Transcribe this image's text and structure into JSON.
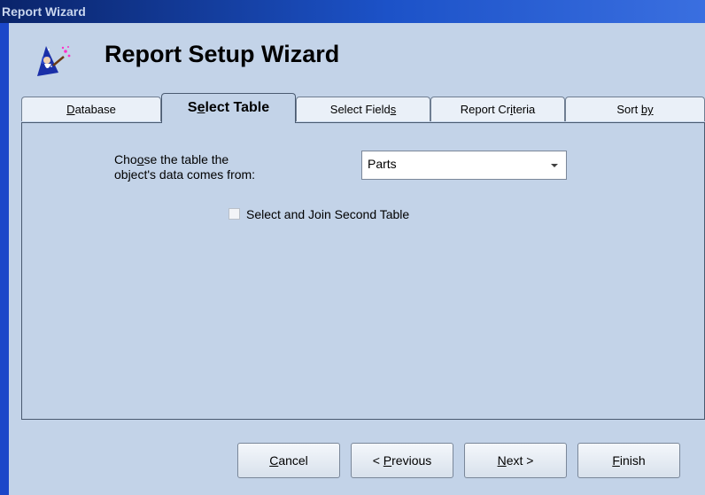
{
  "window": {
    "title": "Report Wizard"
  },
  "heading": "Report Setup Wizard",
  "tabs": [
    {
      "pre": "",
      "u": "D",
      "post": "atabase",
      "active": false
    },
    {
      "pre": "S",
      "u": "e",
      "post": "lect Table",
      "active": true
    },
    {
      "pre": "Select Field",
      "u": "s",
      "post": "",
      "active": false
    },
    {
      "pre": "Report Cr",
      "u": "i",
      "post": "teria",
      "active": false
    },
    {
      "pre": "Sort ",
      "u": "by",
      "post": "",
      "active": false
    }
  ],
  "select_table": {
    "label_line1_pre": "Cho",
    "label_line1_u": "o",
    "label_line1_post": "se the table the",
    "label_line2": "object's data comes from:",
    "table_value": "Parts",
    "second_table_label": "Select and Join Second Table",
    "second_table_checked": false
  },
  "buttons": [
    {
      "u": "C",
      "post": "ancel",
      "pre": ""
    },
    {
      "pre": "< ",
      "u": "P",
      "post": "revious"
    },
    {
      "pre": "",
      "u": "N",
      "post": "ext >"
    },
    {
      "pre": "",
      "u": "F",
      "post": "inish"
    }
  ]
}
